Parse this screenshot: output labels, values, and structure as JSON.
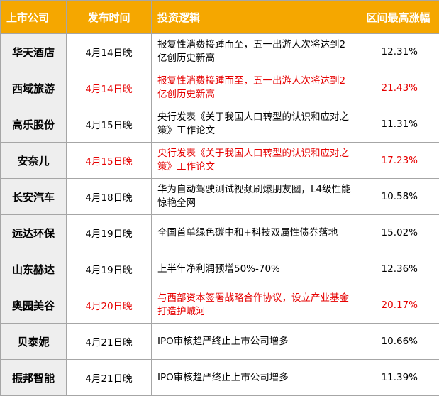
{
  "headers": {
    "company": "上市公司",
    "date": "发布时间",
    "logic": "投资逻辑",
    "rise": "区间最高涨幅"
  },
  "rows": [
    {
      "company": "华天酒店",
      "date": "4月14日晚",
      "logic": "报复性消费接踵而至，五一出游人次将达到2亿创历史新高",
      "rise": "12.31%",
      "highlight": false
    },
    {
      "company": "西域旅游",
      "date": "4月14日晚",
      "logic": "报复性消费接踵而至，五一出游人次将达到2亿创历史新高",
      "rise": "21.43%",
      "highlight": true
    },
    {
      "company": "高乐股份",
      "date": "4月15日晚",
      "logic": "央行发表《关于我国人口转型的认识和应对之策》工作论文",
      "rise": "11.31%",
      "highlight": false
    },
    {
      "company": "安奈儿",
      "date": "4月15日晚",
      "logic": "央行发表《关于我国人口转型的认识和应对之策》工作论文",
      "rise": "17.23%",
      "highlight": true
    },
    {
      "company": "长安汽车",
      "date": "4月18日晚",
      "logic": "华为自动驾驶测试视频刷爆朋友圈，L4级性能惊艳全网",
      "rise": "10.58%",
      "highlight": false
    },
    {
      "company": "远达环保",
      "date": "4月19日晚",
      "logic": "全国首单绿色碳中和+科技双属性债券落地",
      "rise": "15.02%",
      "highlight": false
    },
    {
      "company": "山东赫达",
      "date": "4月19日晚",
      "logic": "上半年净利润预增50%-70%",
      "rise": "12.36%",
      "highlight": false
    },
    {
      "company": "奥园美谷",
      "date": "4月20日晚",
      "logic": "与西部资本签署战略合作协议，设立产业基金打造护城河",
      "rise": "20.17%",
      "highlight": true
    },
    {
      "company": "贝泰妮",
      "date": "4月21日晚",
      "logic": "IPO审核趋严终止上市公司增多",
      "rise": "10.66%",
      "highlight": false
    },
    {
      "company": "振邦智能",
      "date": "4月21日晚",
      "logic": "IPO审核趋严终止上市公司增多",
      "rise": "11.39%",
      "highlight": false
    }
  ],
  "colors": {
    "header_bg": "#f5a700",
    "header_text": "#ffffff",
    "company_bg": "#eeeeee",
    "highlight_text": "#e60000",
    "border": "#a6a6a6"
  }
}
